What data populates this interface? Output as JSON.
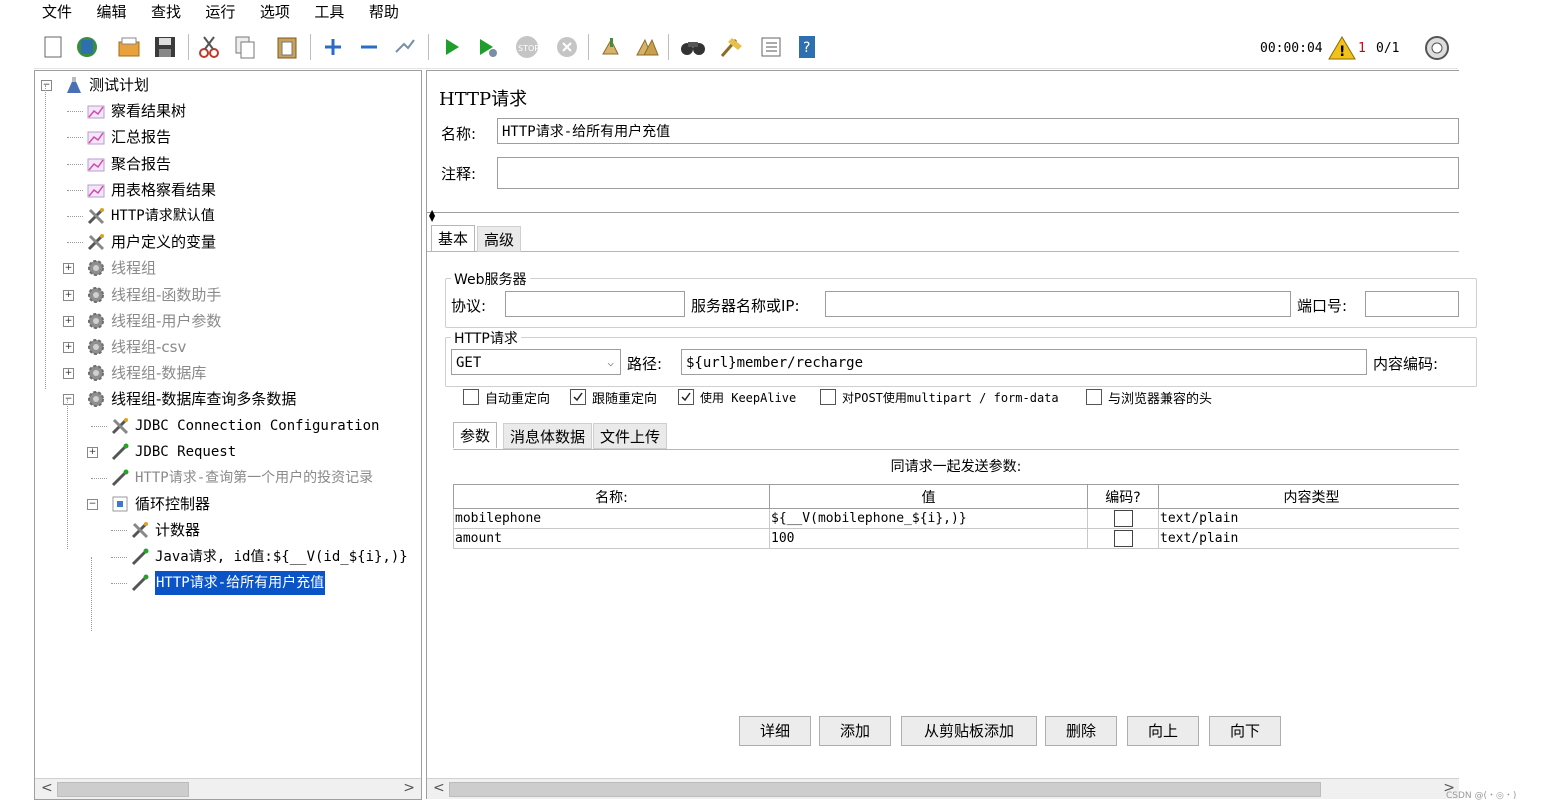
{
  "menu": [
    "文件",
    "编辑",
    "查找",
    "运行",
    "选项",
    "工具",
    "帮助"
  ],
  "toolbar": {
    "icons": [
      "new-icon",
      "templates-icon",
      "open-icon",
      "save-icon",
      "cut-icon",
      "copy-icon",
      "paste-icon",
      "expand-icon",
      "collapse-icon",
      "toggle-icon",
      "start-icon",
      "start-no-pause-icon",
      "stop-icon",
      "shutdown-icon",
      "clear-icon",
      "clear-all-icon",
      "search-icon",
      "reset-search-icon",
      "function-helper-icon",
      "help-icon"
    ],
    "timer": "00:00:04",
    "warn_count": "1",
    "threads": "0/1"
  },
  "tree": {
    "nodes": [
      {
        "label": "测试计划",
        "icon": "test-plan-icon",
        "gray": false
      },
      {
        "label": "察看结果树",
        "icon": "listener-icon",
        "gray": false
      },
      {
        "label": "汇总报告",
        "icon": "listener-icon",
        "gray": false
      },
      {
        "label": "聚合报告",
        "icon": "listener-icon",
        "gray": false
      },
      {
        "label": "用表格察看结果",
        "icon": "listener-icon",
        "gray": false
      },
      {
        "label": "HTTP请求默认值",
        "icon": "config-element-icon",
        "gray": false
      },
      {
        "label": "用户定义的变量",
        "icon": "config-element-icon",
        "gray": false
      },
      {
        "label": "线程组",
        "icon": "thread-group-icon",
        "gray": true
      },
      {
        "label": "线程组-函数助手",
        "icon": "thread-group-icon",
        "gray": true
      },
      {
        "label": "线程组-用户参数",
        "icon": "thread-group-icon",
        "gray": true
      },
      {
        "label": "线程组-csv",
        "icon": "thread-group-icon",
        "gray": true
      },
      {
        "label": "线程组-数据库",
        "icon": "thread-group-icon",
        "gray": true
      },
      {
        "label": "线程组-数据库查询多条数据",
        "icon": "thread-group-icon",
        "gray": false
      },
      {
        "label": "JDBC Connection Configuration",
        "icon": "config-element-icon",
        "gray": false
      },
      {
        "label": "JDBC Request",
        "icon": "sampler-icon",
        "gray": false
      },
      {
        "label": "HTTP请求-查询第一个用户的投资记录",
        "icon": "sampler-icon",
        "gray": true
      },
      {
        "label": "循环控制器",
        "icon": "loop-controller-icon",
        "gray": false
      },
      {
        "label": "计数器",
        "icon": "config-element-icon",
        "gray": false
      },
      {
        "label": "Java请求, id值:${__V(id_${i},)}",
        "icon": "sampler-icon",
        "gray": false
      },
      {
        "label": "HTTP请求-给所有用户充值",
        "icon": "sampler-icon",
        "gray": false,
        "selected": true
      }
    ]
  },
  "panel": {
    "title": "HTTP请求",
    "name_label": "名称:",
    "name_value": "HTTP请求-给所有用户充值",
    "comment_label": "注释:",
    "comment_value": "",
    "tabs": [
      "基本",
      "高级"
    ],
    "web_server": {
      "title": "Web服务器",
      "protocol_label": "协议:",
      "protocol_value": "",
      "server_label": "服务器名称或IP:",
      "server_value": "",
      "port_label": "端口号:",
      "port_value": ""
    },
    "http_request": {
      "title": "HTTP请求",
      "method": "GET",
      "path_label": "路径:",
      "path_value": "${url}member/recharge",
      "encoding_label": "内容编码:"
    },
    "checkboxes": [
      {
        "label": "自动重定向",
        "checked": false
      },
      {
        "label": "跟随重定向",
        "checked": true
      },
      {
        "label": "使用 KeepAlive",
        "checked": true
      },
      {
        "label": "对POST使用multipart / form-data",
        "checked": false
      },
      {
        "label": "与浏览器兼容的头",
        "checked": false
      }
    ],
    "sub_tabs": [
      "参数",
      "消息体数据",
      "文件上传"
    ],
    "params_caption": "同请求一起发送参数:",
    "columns": [
      "名称:",
      "值",
      "编码?",
      "内容类型"
    ],
    "rows": [
      {
        "name": "mobilephone",
        "value": "${__V(mobilephone_${i},)}",
        "encode": false,
        "type": "text/plain"
      },
      {
        "name": "amount",
        "value": "100",
        "encode": false,
        "type": "text/plain"
      }
    ],
    "buttons": [
      "详细",
      "添加",
      "从剪贴板添加",
      "删除",
      "向上",
      "向下"
    ]
  },
  "watermark": "CSDN @(・◎・)"
}
